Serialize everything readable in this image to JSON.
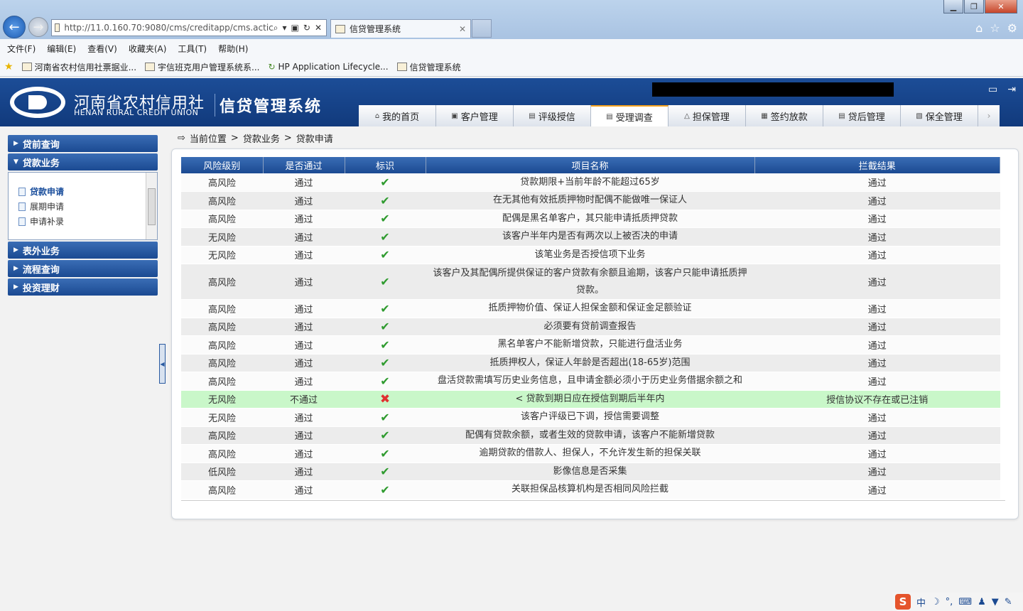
{
  "browser": {
    "address": "http://11.0.160.70:9080/cms/creditapp/cms.actic",
    "tab_title": "信贷管理系统",
    "menu": [
      "文件(F)",
      "编辑(E)",
      "查看(V)",
      "收藏夹(A)",
      "工具(T)",
      "帮助(H)"
    ],
    "favorites": [
      "河南省农村信用社票据业...",
      "宇信班克用户管理系统系...",
      "HP Application Lifecycle...",
      "信贷管理系统"
    ]
  },
  "header": {
    "org_cn": "河南省农村信用社",
    "org_en": "HENAN RURAL CREDIT UNION",
    "system": "信贷管理系统",
    "nav": [
      {
        "label": "我的首页",
        "icon": "home-icon"
      },
      {
        "label": "客户管理",
        "icon": "user-icon"
      },
      {
        "label": "评级授信",
        "icon": "grid-icon"
      },
      {
        "label": "受理调查",
        "icon": "doc-icon",
        "active": true
      },
      {
        "label": "担保管理",
        "icon": "warning-icon"
      },
      {
        "label": "签约放款",
        "icon": "sign-icon"
      },
      {
        "label": "贷后管理",
        "icon": "list-icon"
      },
      {
        "label": "保全管理",
        "icon": "shield-icon"
      }
    ]
  },
  "sidebar": {
    "sections": [
      "贷前查询",
      "贷款业务",
      "表外业务",
      "流程查询",
      "投资理财"
    ],
    "items": [
      "贷款申请",
      "展期申请",
      "申请补录"
    ]
  },
  "breadcrumb": {
    "label": "当前位置",
    "sep": ">",
    "path1": "贷款业务",
    "path2": "贷款申请"
  },
  "table": {
    "headers": [
      "风险级别",
      "是否通过",
      "标识",
      "项目名称",
      "拦截结果"
    ],
    "rows": [
      {
        "risk": "高风险",
        "pass": "通过",
        "mark": "ok",
        "name": "贷款期限+当前年龄不能超过65岁",
        "result": "通过"
      },
      {
        "risk": "高风险",
        "pass": "通过",
        "mark": "ok",
        "name": "在无其他有效抵质押物时配偶不能做唯一保证人",
        "result": "通过"
      },
      {
        "risk": "高风险",
        "pass": "通过",
        "mark": "ok",
        "name": "配偶是黑名单客户，其只能申请抵质押贷款",
        "result": "通过"
      },
      {
        "risk": "无风险",
        "pass": "通过",
        "mark": "ok",
        "name": "该客户半年内是否有两次以上被否决的申请",
        "result": "通过"
      },
      {
        "risk": "无风险",
        "pass": "通过",
        "mark": "ok",
        "name": "该笔业务是否授信项下业务",
        "result": "通过"
      },
      {
        "risk": "高风险",
        "pass": "通过",
        "mark": "ok",
        "name": "该客户及其配偶所提供保证的客户贷款有余额且逾期，该客户只能申请抵质押贷款。",
        "result": "通过",
        "tall": true
      },
      {
        "risk": "高风险",
        "pass": "通过",
        "mark": "ok",
        "name": "抵质押物价值、保证人担保金额和保证金足额验证",
        "result": "通过"
      },
      {
        "risk": "高风险",
        "pass": "通过",
        "mark": "ok",
        "name": "必须要有贷前调查报告",
        "result": "通过"
      },
      {
        "risk": "高风险",
        "pass": "通过",
        "mark": "ok",
        "name": "黑名单客户不能新增贷款，只能进行盘活业务",
        "result": "通过"
      },
      {
        "risk": "高风险",
        "pass": "通过",
        "mark": "ok",
        "name": "抵质押权人，保证人年龄是否超出(18-65岁)范围",
        "result": "通过"
      },
      {
        "risk": "高风险",
        "pass": "通过",
        "mark": "ok",
        "name": "盘活贷款需填写历史业务信息，且申请金额必须小于历史业务借据余额之和",
        "result": "通过"
      },
      {
        "risk": "无风险",
        "pass": "不通过",
        "mark": "fail",
        "name": "< 贷款到期日应在授信到期后半年内",
        "result": "授信协议不存在或已注销",
        "fail": true
      },
      {
        "risk": "无风险",
        "pass": "通过",
        "mark": "ok",
        "name": "该客户评级已下调，授信需要调整",
        "result": "通过"
      },
      {
        "risk": "高风险",
        "pass": "通过",
        "mark": "ok",
        "name": "配偶有贷款余额，或者生效的贷款申请，该客户不能新增贷款",
        "result": "通过"
      },
      {
        "risk": "高风险",
        "pass": "通过",
        "mark": "ok",
        "name": "逾期贷款的借款人、担保人，不允许发生新的担保关联",
        "result": "通过"
      },
      {
        "risk": "低风险",
        "pass": "通过",
        "mark": "ok",
        "name": "影像信息是否采集",
        "result": "通过"
      },
      {
        "risk": "高风险",
        "pass": "通过",
        "mark": "ok",
        "name": "关联担保品核算机构是否相同风险拦截",
        "result": "通过"
      }
    ]
  },
  "ime": {
    "lang": "中"
  }
}
